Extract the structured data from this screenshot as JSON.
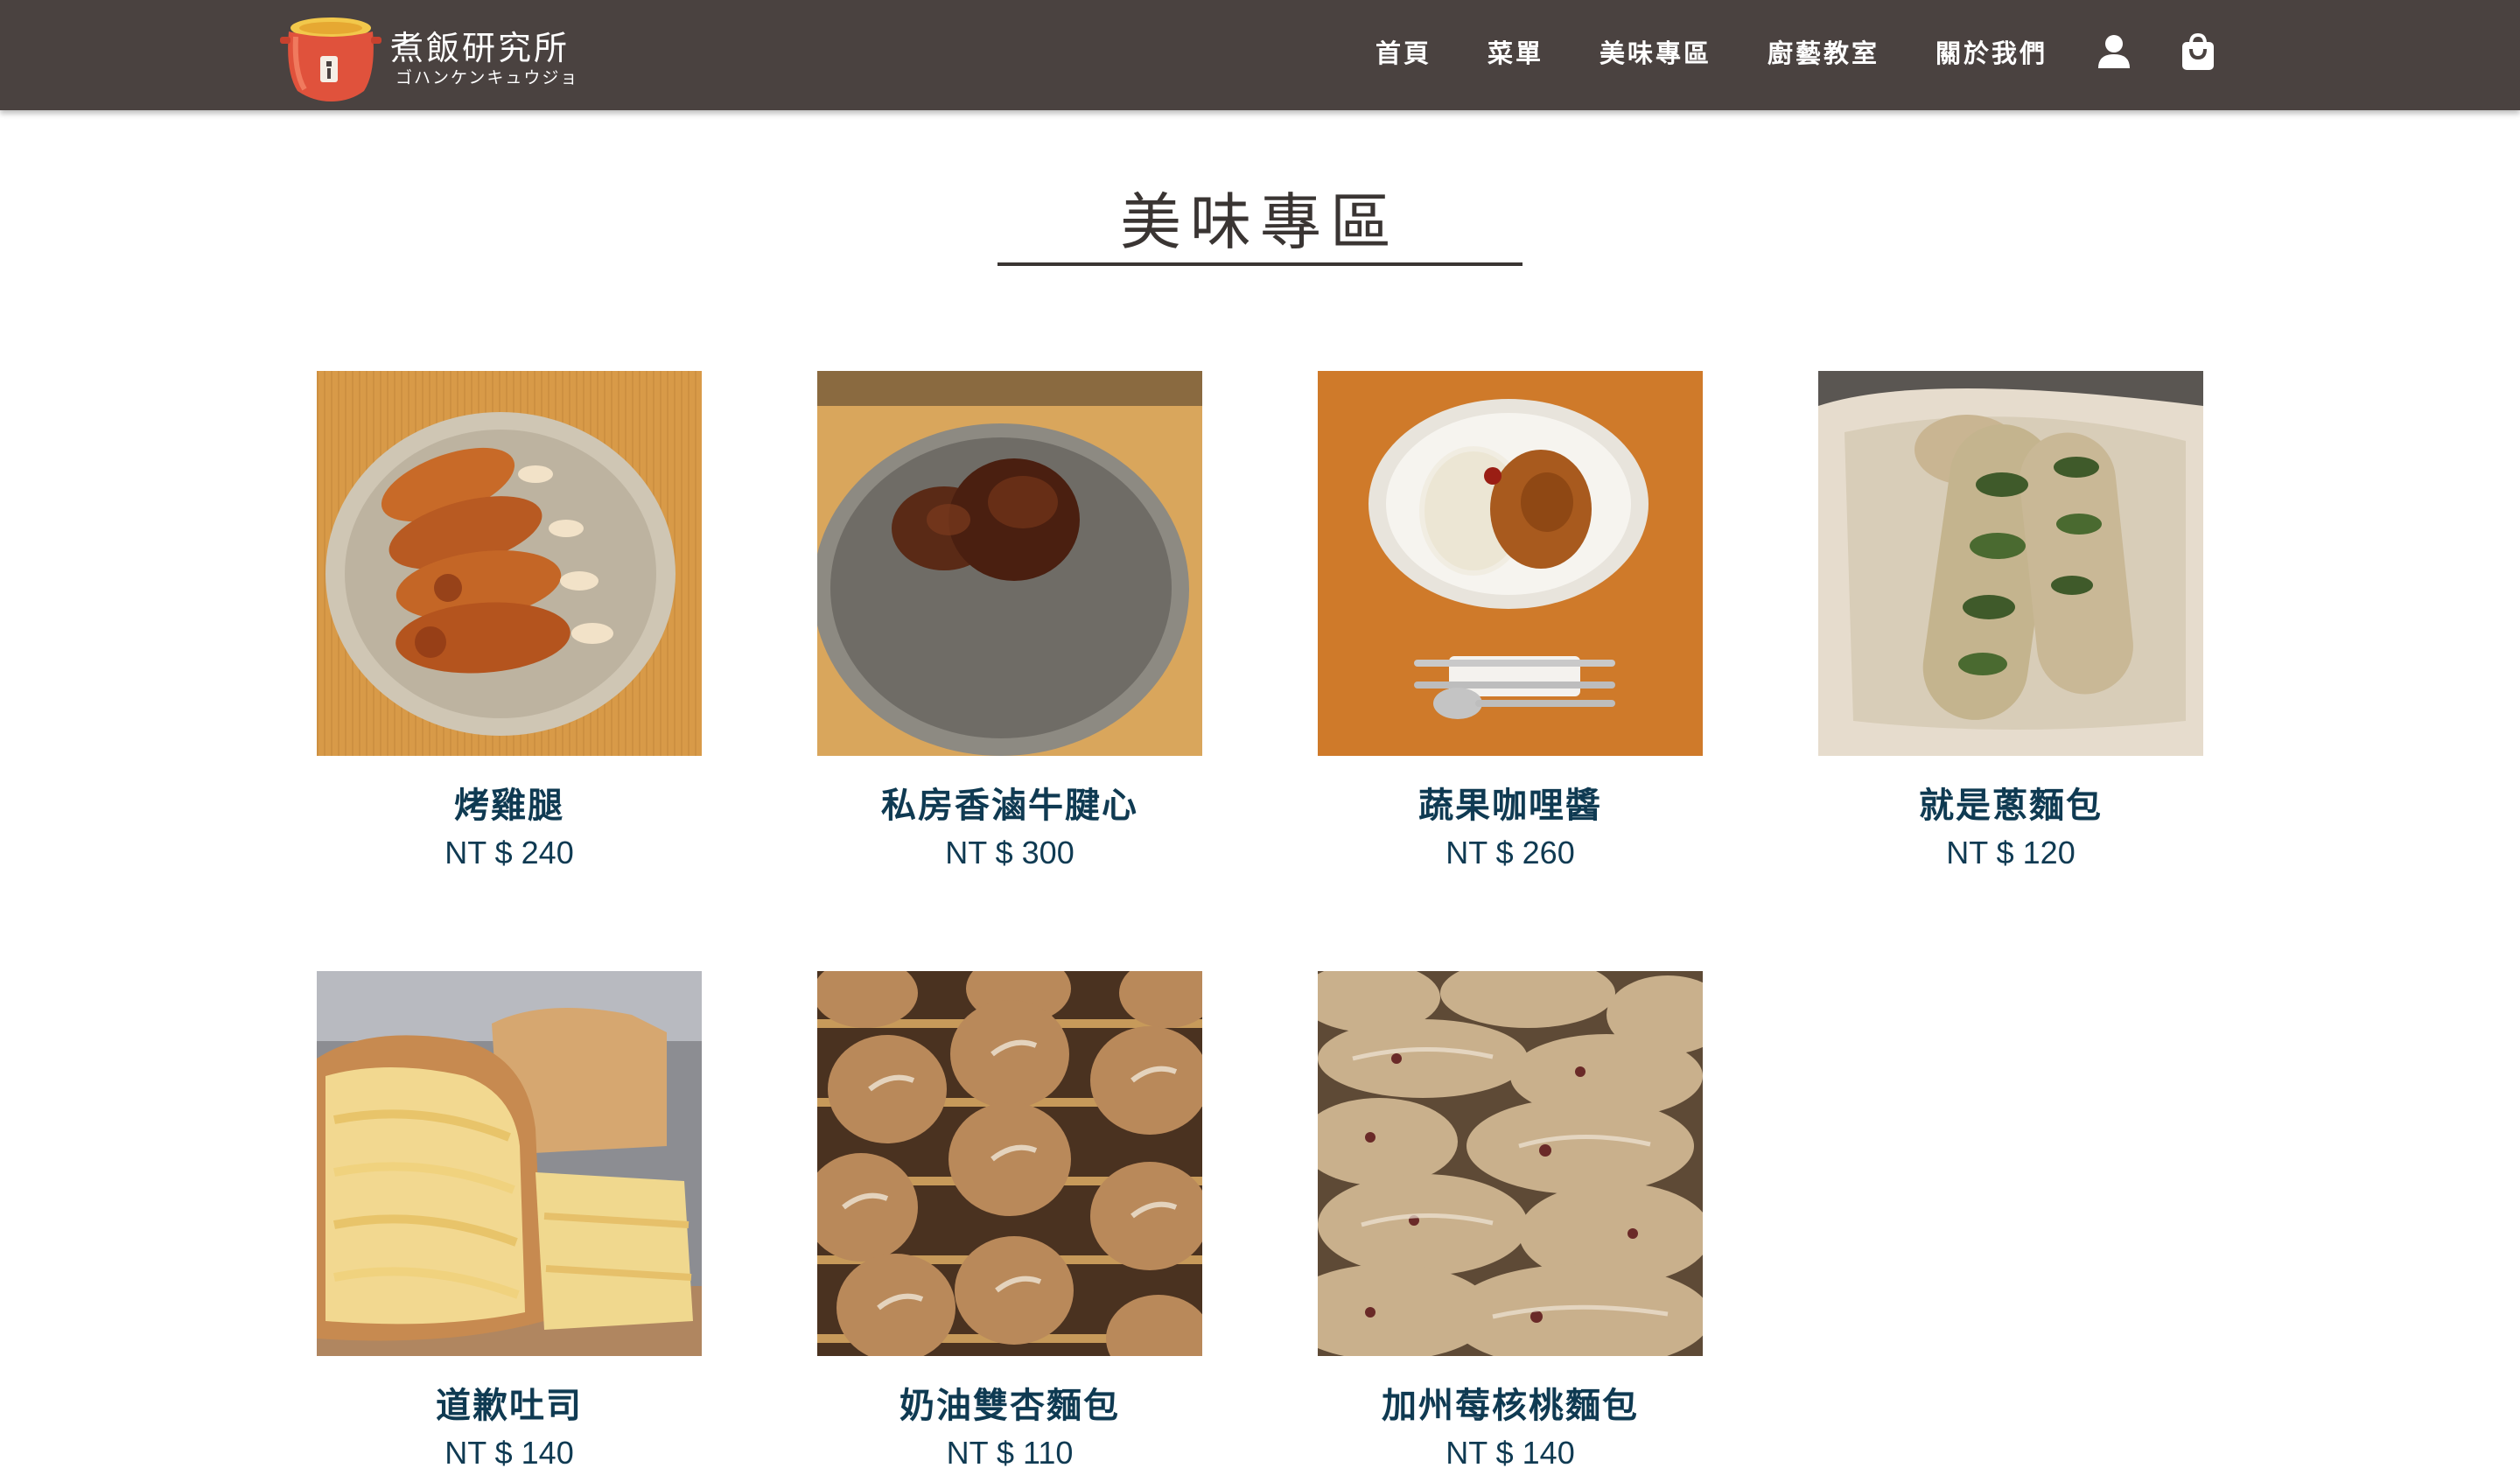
{
  "brand": {
    "name": "煮飯研究所",
    "subtitle": "ゴハンケンキュウジョ"
  },
  "nav": {
    "items": [
      {
        "label": "首頁"
      },
      {
        "label": "菜單"
      },
      {
        "label": "美味專區"
      },
      {
        "label": "廚藝教室"
      },
      {
        "label": "關於我們"
      }
    ],
    "account_icon": "user-icon",
    "cart_icon": "shopping-bag-icon"
  },
  "page": {
    "title": "美味專區"
  },
  "products": [
    {
      "name": "烤雞腿",
      "price": "NT $ 240",
      "image": "roast-chicken-drumsticks"
    },
    {
      "name": "私房香滷牛腱心",
      "price": "NT $ 300",
      "image": "braised-beef-shank"
    },
    {
      "name": "蔬果咖哩醬",
      "price": "NT $ 260",
      "image": "curry-rice"
    },
    {
      "name": "就是蔥麵包",
      "price": "NT $ 120",
      "image": "scallion-bread"
    },
    {
      "name": "道歉吐司",
      "price": "NT $ 140",
      "image": "toast-loaf"
    },
    {
      "name": "奶油雙杏麵包",
      "price": "NT $ 110",
      "image": "butter-apricot-buns"
    },
    {
      "name": "加州莓核桃麵包",
      "price": "NT $ 140",
      "image": "cranberry-walnut-bread"
    }
  ],
  "colors": {
    "navbar": "#4a4240",
    "text": "#0f3a52",
    "title": "#3a3533"
  }
}
